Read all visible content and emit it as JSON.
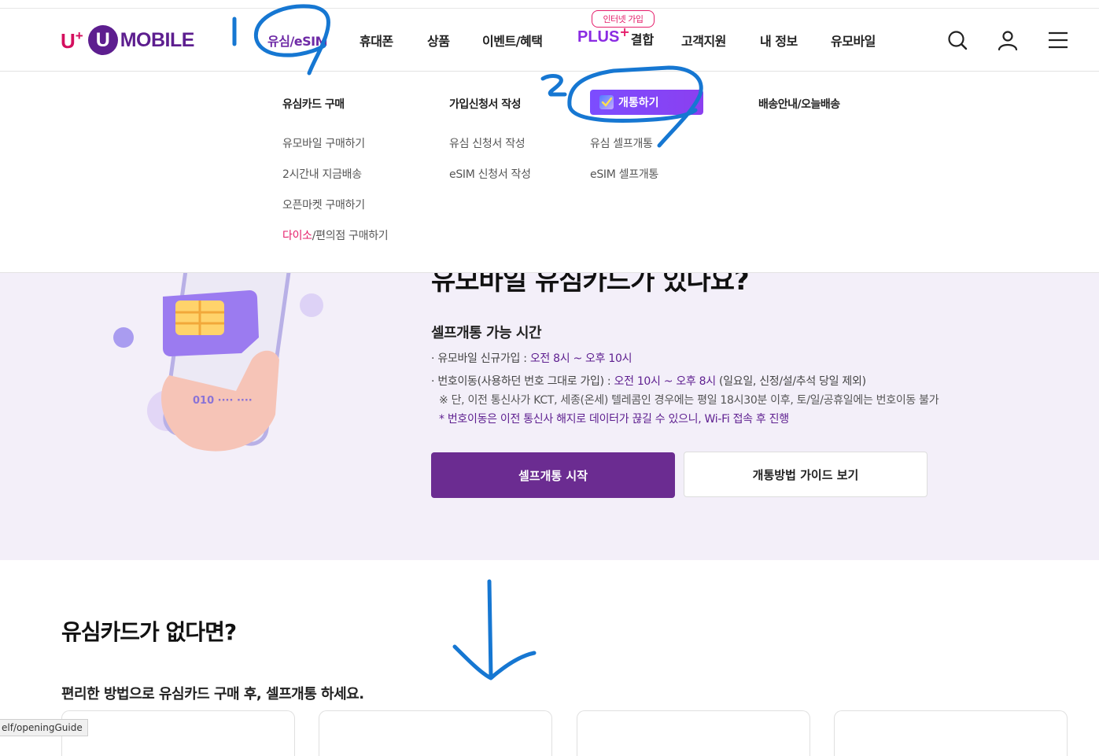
{
  "header": {
    "logo": {
      "uplus": "U",
      "plus_sign": "+",
      "u_mark": "U",
      "mobile": "MOBILE"
    },
    "nav": [
      {
        "label": "유심/eSIM"
      },
      {
        "label": "휴대폰"
      },
      {
        "label": "상품"
      },
      {
        "label": "이벤트/혜택"
      },
      {
        "label": "PLUS",
        "star": "+",
        "suffix": "결합",
        "badge": "인터넷 가입"
      },
      {
        "label": "고객지원"
      },
      {
        "label": "내 정보"
      },
      {
        "label": "유모바일"
      }
    ],
    "icons": [
      "search-icon",
      "user-icon",
      "menu-icon"
    ]
  },
  "mega_menu": {
    "columns": [
      {
        "heading": "유심카드 구매",
        "items": [
          "유모바일 구매하기",
          "2시간내 지금배송",
          "오픈마켓 구매하기"
        ],
        "special_item": {
          "highlight": "다이소",
          "rest": "/편의점 구매하기"
        }
      },
      {
        "heading": "가입신청서 작성",
        "items": [
          "유심 신청서 작성",
          "eSIM 신청서 작성"
        ]
      },
      {
        "heading": "개통하기",
        "items": [
          "유심 셀프개통",
          "eSIM 셀프개통"
        ]
      },
      {
        "heading": "배송안내/오늘배송",
        "items": []
      }
    ]
  },
  "hero": {
    "title": "유모바일 유심카드가 있나요?",
    "subtitle": "셀프개통 가능 시간",
    "line1_label": "유모바일 신규가입 : ",
    "line1_value": "오전 8시 ~ 오후 10시",
    "line2_label": "번호이동(사용하던 번호 그대로 가입) : ",
    "line2_value": "오전 10시 ~ 오후 8시",
    "line2_suffix": " (일요일, 신정/설/추석 당일 제외)",
    "note1": "※ 단, 이전 통신사가 KCT, 세종(온세) 텔레콤인 경우에는 평일 18시30분 이후, 토/일/공휴일에는 번호이동 불가",
    "note2": "* 번호이동은 이전 통신사 해지로 데이터가 끊길 수 있으니, Wi-Fi 접속 후 진행",
    "primary_button": "셀프개통 시작",
    "secondary_button": "개통방법 가이드 보기",
    "phone_number_text": "010 ···· ····"
  },
  "lower": {
    "title": "유심카드가 없다면?",
    "subtitle": "편리한 방법으로 유심카드 구매 후, 셀프개통 하세요."
  },
  "status_url": "elf/openingGuide",
  "colors": {
    "brand_purple": "#6b2c91",
    "brand_pink": "#e51d6a",
    "hero_bg": "#f3eff9",
    "annotation_blue": "#1677d2"
  }
}
